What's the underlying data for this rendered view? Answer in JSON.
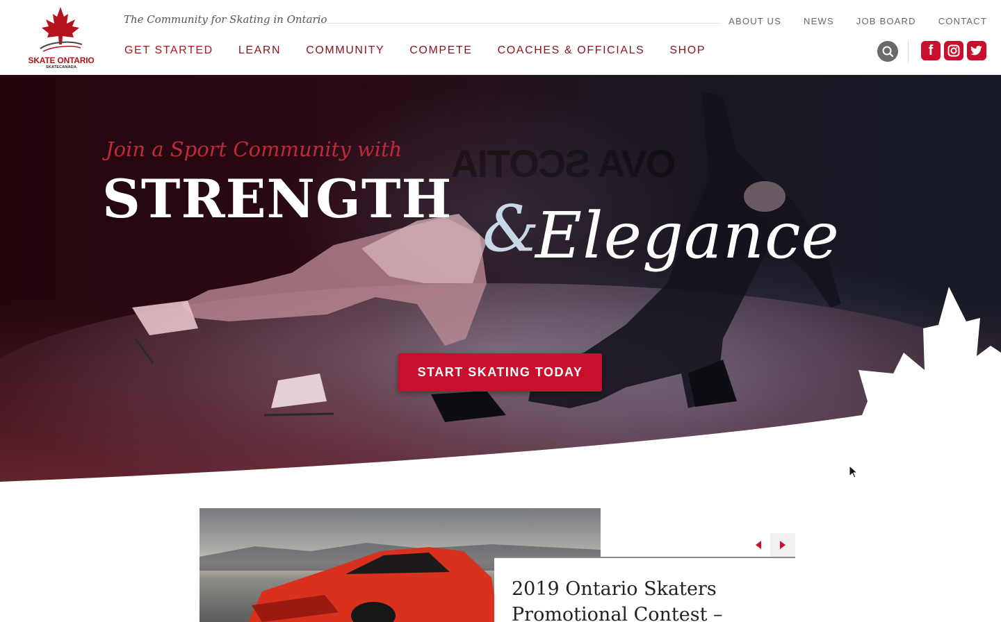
{
  "brand": {
    "logo_name": "SKATE ONTARIO",
    "logo_sub": "SKATECANADA",
    "tagline": "The Community for Skating in Ontario",
    "accent_color": "#c8102e",
    "dark_accent_color": "#8a1522"
  },
  "top_nav": [
    {
      "label": "ABOUT US"
    },
    {
      "label": "NEWS"
    },
    {
      "label": "JOB BOARD"
    },
    {
      "label": "CONTACT"
    }
  ],
  "main_nav": [
    {
      "label": "GET STARTED"
    },
    {
      "label": "LEARN"
    },
    {
      "label": "COMMUNITY"
    },
    {
      "label": "COMPETE"
    },
    {
      "label": "COACHES & OFFICIALS"
    },
    {
      "label": "SHOP"
    }
  ],
  "header_icons": {
    "search": "search-icon",
    "facebook": "facebook-icon",
    "instagram": "instagram-icon",
    "twitter": "twitter-icon"
  },
  "hero": {
    "kicker": "Join a Sport Community with",
    "headline_1": "STRENGTH",
    "ampersand": "&",
    "headline_2": "Elegance",
    "background_banner": "OVA SCOTIA",
    "cta_label": "START SKATING TODAY"
  },
  "feature": {
    "title_line_1": "2019 Ontario Skaters",
    "title_line_2": "Promotional Contest –",
    "prev_icon": "chevron-left-icon",
    "next_icon": "chevron-right-icon"
  }
}
